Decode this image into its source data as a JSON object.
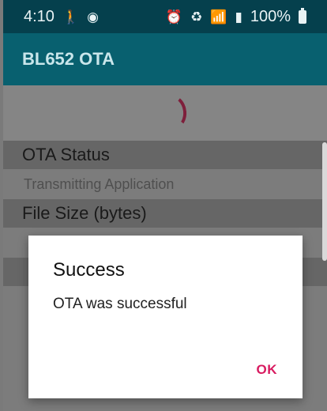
{
  "status_bar": {
    "time": "4:10",
    "battery": "100%",
    "left_icons": [
      "walking-icon",
      "messenger-icon"
    ],
    "right_icons": [
      "alarm-icon",
      "sync-icon",
      "wifi-icon",
      "signal-icon",
      "battery-icon"
    ]
  },
  "app": {
    "title": "BL652 OTA"
  },
  "sections": {
    "ota_status": {
      "label": "OTA Status",
      "value": "Transmitting Application"
    },
    "file_size": {
      "label": "File Size (bytes)",
      "value": ""
    },
    "third": {
      "label": "",
      "value": ""
    }
  },
  "dialog": {
    "title": "Success",
    "message": "OTA was successful",
    "ok_label": "OK"
  },
  "colors": {
    "status_bar": "#05404d",
    "app_bar": "#08606f",
    "accent": "#d81b60"
  }
}
